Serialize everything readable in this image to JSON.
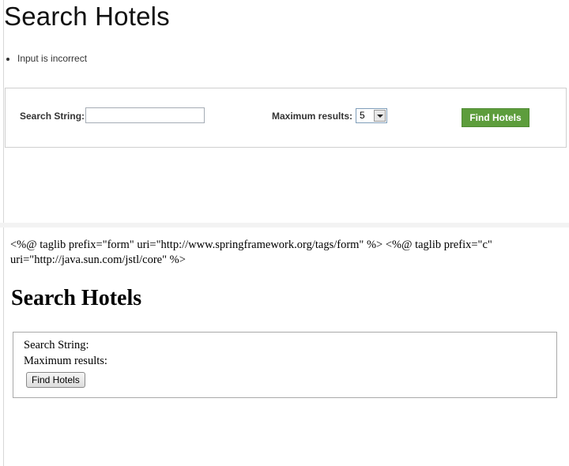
{
  "styled_view": {
    "title": "Search Hotels",
    "errors": [
      "Input is incorrect"
    ],
    "search_label": "Search String:",
    "search_value": "",
    "max_label": "Maximum results:",
    "max_selected": "5",
    "find_button": "Find Hotels",
    "colors": {
      "button_bg": "#5d9d3c",
      "button_text": "#ffffff"
    }
  },
  "raw_view": {
    "taglib_text": "<%@ taglib prefix=\"form\" uri=\"http://www.springframework.org/tags/form\" %> <%@ taglib prefix=\"c\" uri=\"http://java.sun.com/jstl/core\" %>",
    "title": "Search Hotels",
    "search_label": "Search String:",
    "max_label": "Maximum results:",
    "find_button": "Find Hotels"
  }
}
